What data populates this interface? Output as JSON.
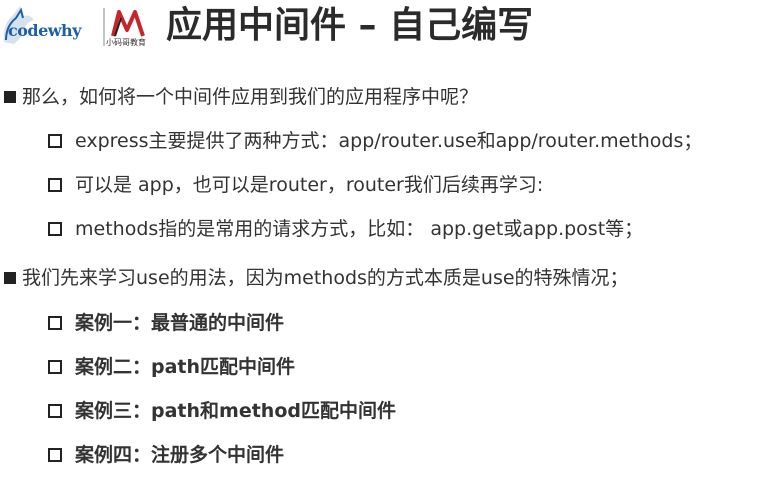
{
  "header": {
    "logo_text": "codewhy",
    "brand_logo_text": "小码哥教育",
    "title": "应用中间件 – 自己编写"
  },
  "content": {
    "items": [
      {
        "level": 1,
        "text": "那么，如何将一个中间件应用到我们的应用程序中呢？",
        "bold": false
      },
      {
        "level": 2,
        "text": "express主要提供了两种方式：app/router.use和app/router.methods；",
        "bold": false
      },
      {
        "level": 2,
        "text": "可以是 app，也可以是router，router我们后续再学习:",
        "bold": false
      },
      {
        "level": 2,
        "text": "methods指的是常用的请求方式，比如： app.get或app.post等；",
        "bold": false
      },
      {
        "level": 1,
        "text": "我们先来学习use的用法，因为methods的方式本质是use的特殊情况；",
        "bold": false
      },
      {
        "level": 2,
        "text": "案例一：最普通的中间件",
        "bold": true
      },
      {
        "level": 2,
        "text": "案例二：path匹配中间件",
        "bold": true
      },
      {
        "level": 2,
        "text": "案例三：path和method匹配中间件",
        "bold": true
      },
      {
        "level": 2,
        "text": "案例四：注册多个中间件",
        "bold": true
      }
    ]
  },
  "colors": {
    "text": "#333333",
    "title": "#2b2b2b",
    "logo_blue": "#1f5fa8",
    "logo_red": "#c8242b"
  }
}
